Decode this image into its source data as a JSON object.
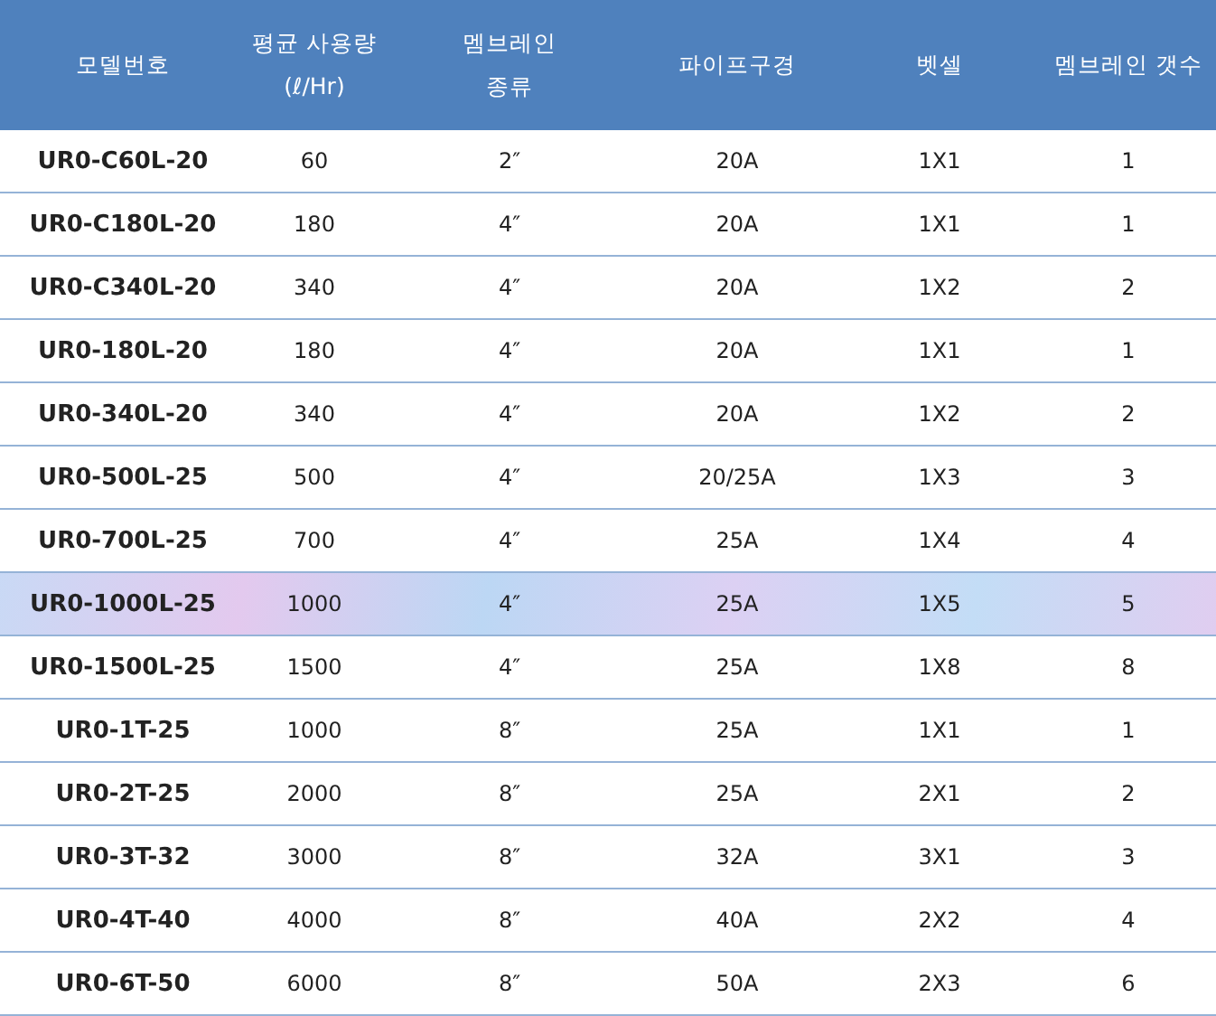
{
  "table": {
    "columns": [
      {
        "lines": [
          "모델번호"
        ]
      },
      {
        "lines": [
          "평균 사용량",
          "(ℓ/Hr)"
        ]
      },
      {
        "lines": [
          "멤브레인",
          "종류"
        ]
      },
      {
        "lines": [
          "파이프구경"
        ]
      },
      {
        "lines": [
          "벳셀"
        ]
      },
      {
        "lines": [
          "멤브레인 갯수"
        ]
      }
    ],
    "rows": [
      {
        "selected": false,
        "cells": [
          "UR0-C60L-20",
          "60",
          "2″",
          "20A",
          "1X1",
          "1"
        ]
      },
      {
        "selected": false,
        "cells": [
          "UR0-C180L-20",
          "180",
          "4″",
          "20A",
          "1X1",
          "1"
        ]
      },
      {
        "selected": false,
        "cells": [
          "UR0-C340L-20",
          "340",
          "4″",
          "20A",
          "1X2",
          "2"
        ]
      },
      {
        "selected": false,
        "cells": [
          "UR0-180L-20",
          "180",
          "4″",
          "20A",
          "1X1",
          "1"
        ]
      },
      {
        "selected": false,
        "cells": [
          "UR0-340L-20",
          "340",
          "4″",
          "20A",
          "1X2",
          "2"
        ]
      },
      {
        "selected": false,
        "cells": [
          "UR0-500L-25",
          "500",
          "4″",
          "20/25A",
          "1X3",
          "3"
        ]
      },
      {
        "selected": false,
        "cells": [
          "UR0-700L-25",
          "700",
          "4″",
          "25A",
          "1X4",
          "4"
        ]
      },
      {
        "selected": true,
        "cells": [
          "UR0-1000L-25",
          "1000",
          "4″",
          "25A",
          "1X5",
          "5"
        ]
      },
      {
        "selected": false,
        "cells": [
          "UR0-1500L-25",
          "1500",
          "4″",
          "25A",
          "1X8",
          "8"
        ]
      },
      {
        "selected": false,
        "cells": [
          "UR0-1T-25",
          "1000",
          "8″",
          "25A",
          "1X1",
          "1"
        ]
      },
      {
        "selected": false,
        "cells": [
          "UR0-2T-25",
          "2000",
          "8″",
          "25A",
          "2X1",
          "2"
        ]
      },
      {
        "selected": false,
        "cells": [
          "UR0-3T-32",
          "3000",
          "8″",
          "32A",
          "3X1",
          "3"
        ]
      },
      {
        "selected": false,
        "cells": [
          "UR0-4T-40",
          "4000",
          "8″",
          "40A",
          "2X2",
          "4"
        ]
      },
      {
        "selected": false,
        "cells": [
          "UR0-6T-50",
          "6000",
          "8″",
          "50A",
          "2X3",
          "6"
        ]
      }
    ]
  }
}
